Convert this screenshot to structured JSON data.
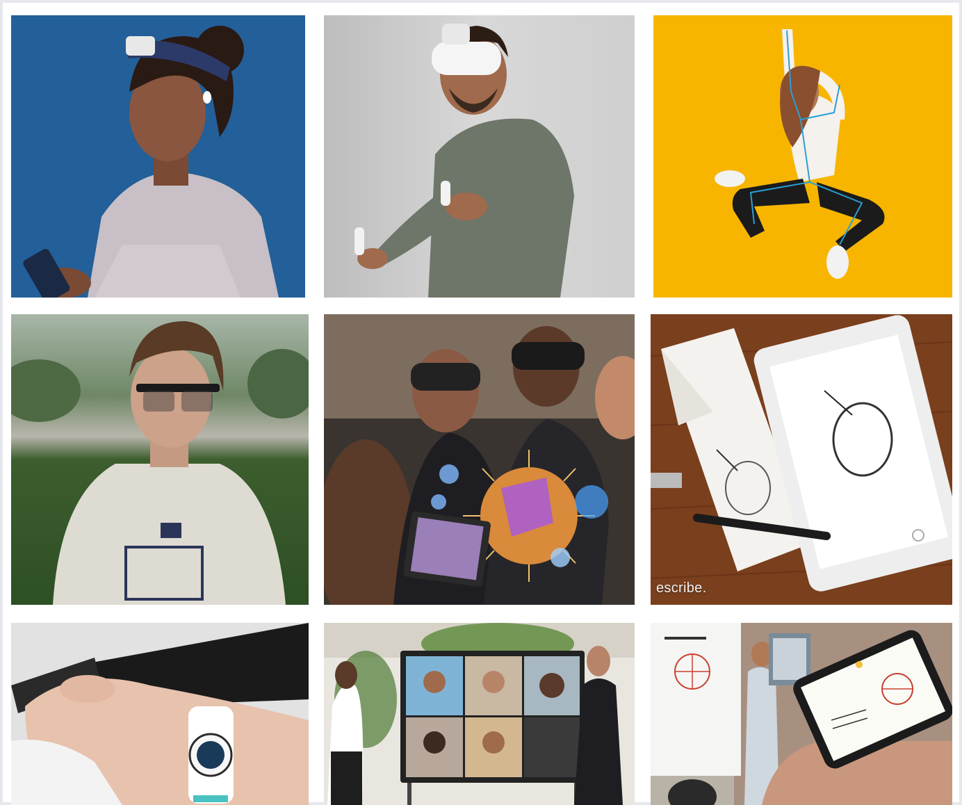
{
  "grid": {
    "tiles": [
      {
        "id": "tile-eeg-headband",
        "icon": "eeg-headband-photo"
      },
      {
        "id": "tile-vr-headset",
        "icon": "vr-headset-photo"
      },
      {
        "id": "tile-motion-capture",
        "icon": "motion-capture-photo"
      },
      {
        "id": "tile-eye-tracking-glasses",
        "icon": "eye-tracking-photo"
      },
      {
        "id": "tile-mixed-reality",
        "icon": "mixed-reality-photo"
      },
      {
        "id": "tile-smart-pen",
        "icon": "smart-pen-photo",
        "caption": "escribe."
      },
      {
        "id": "tile-smartwatch",
        "icon": "smartwatch-photo"
      },
      {
        "id": "tile-video-conference",
        "icon": "video-conference-photo"
      },
      {
        "id": "tile-whiteboard-capture",
        "icon": "whiteboard-photo"
      }
    ]
  },
  "colors": {
    "frame_border": "#e6e8ee",
    "tile1_bg": "#1f5a93",
    "tile2_bg": "#c9c9c9",
    "tile3_bg": "#f7b500",
    "tile4_bg": "#4f6a48",
    "tile5_bg": "#3a3430",
    "tile6_bg": "#7a3f1d",
    "tile7_bg": "#d9d9d9",
    "tile8_bg": "#e9e6df",
    "tile9_bg": "#b9b2a6"
  }
}
